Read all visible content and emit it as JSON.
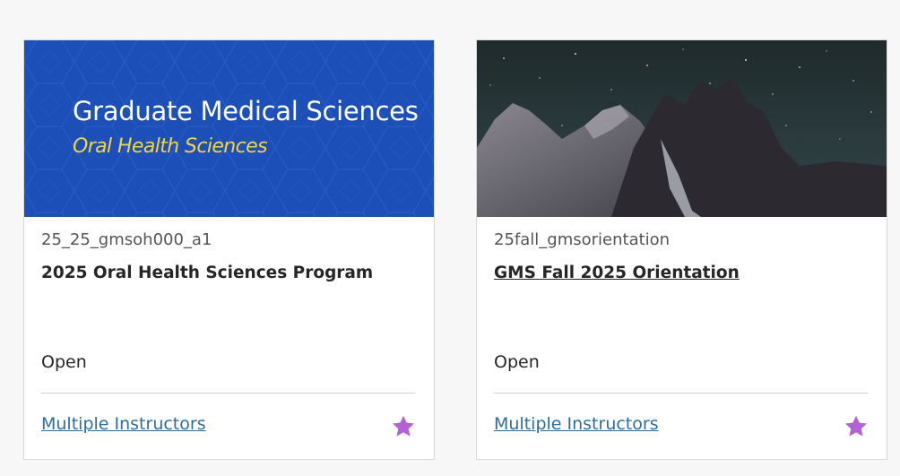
{
  "courses": [
    {
      "banner_title": "Graduate Medical Sciences",
      "banner_subtitle": "Oral Health Sciences",
      "course_id": "25_25_gmsoh000_a1",
      "name": "2025 Oral Health Sciences Program",
      "status": "Open",
      "instructors_label": "Multiple Instructors",
      "favorite_icon": "star-icon",
      "favorite_color": "#b461d5",
      "banner_color": "#1d4fb8"
    },
    {
      "course_id": "25fall_gmsorientation",
      "name": "GMS Fall 2025 Orientation",
      "status": "Open",
      "instructors_label": "Multiple Instructors",
      "favorite_icon": "star-icon",
      "favorite_color": "#b461d5",
      "image": "night-sky-mountains"
    }
  ]
}
